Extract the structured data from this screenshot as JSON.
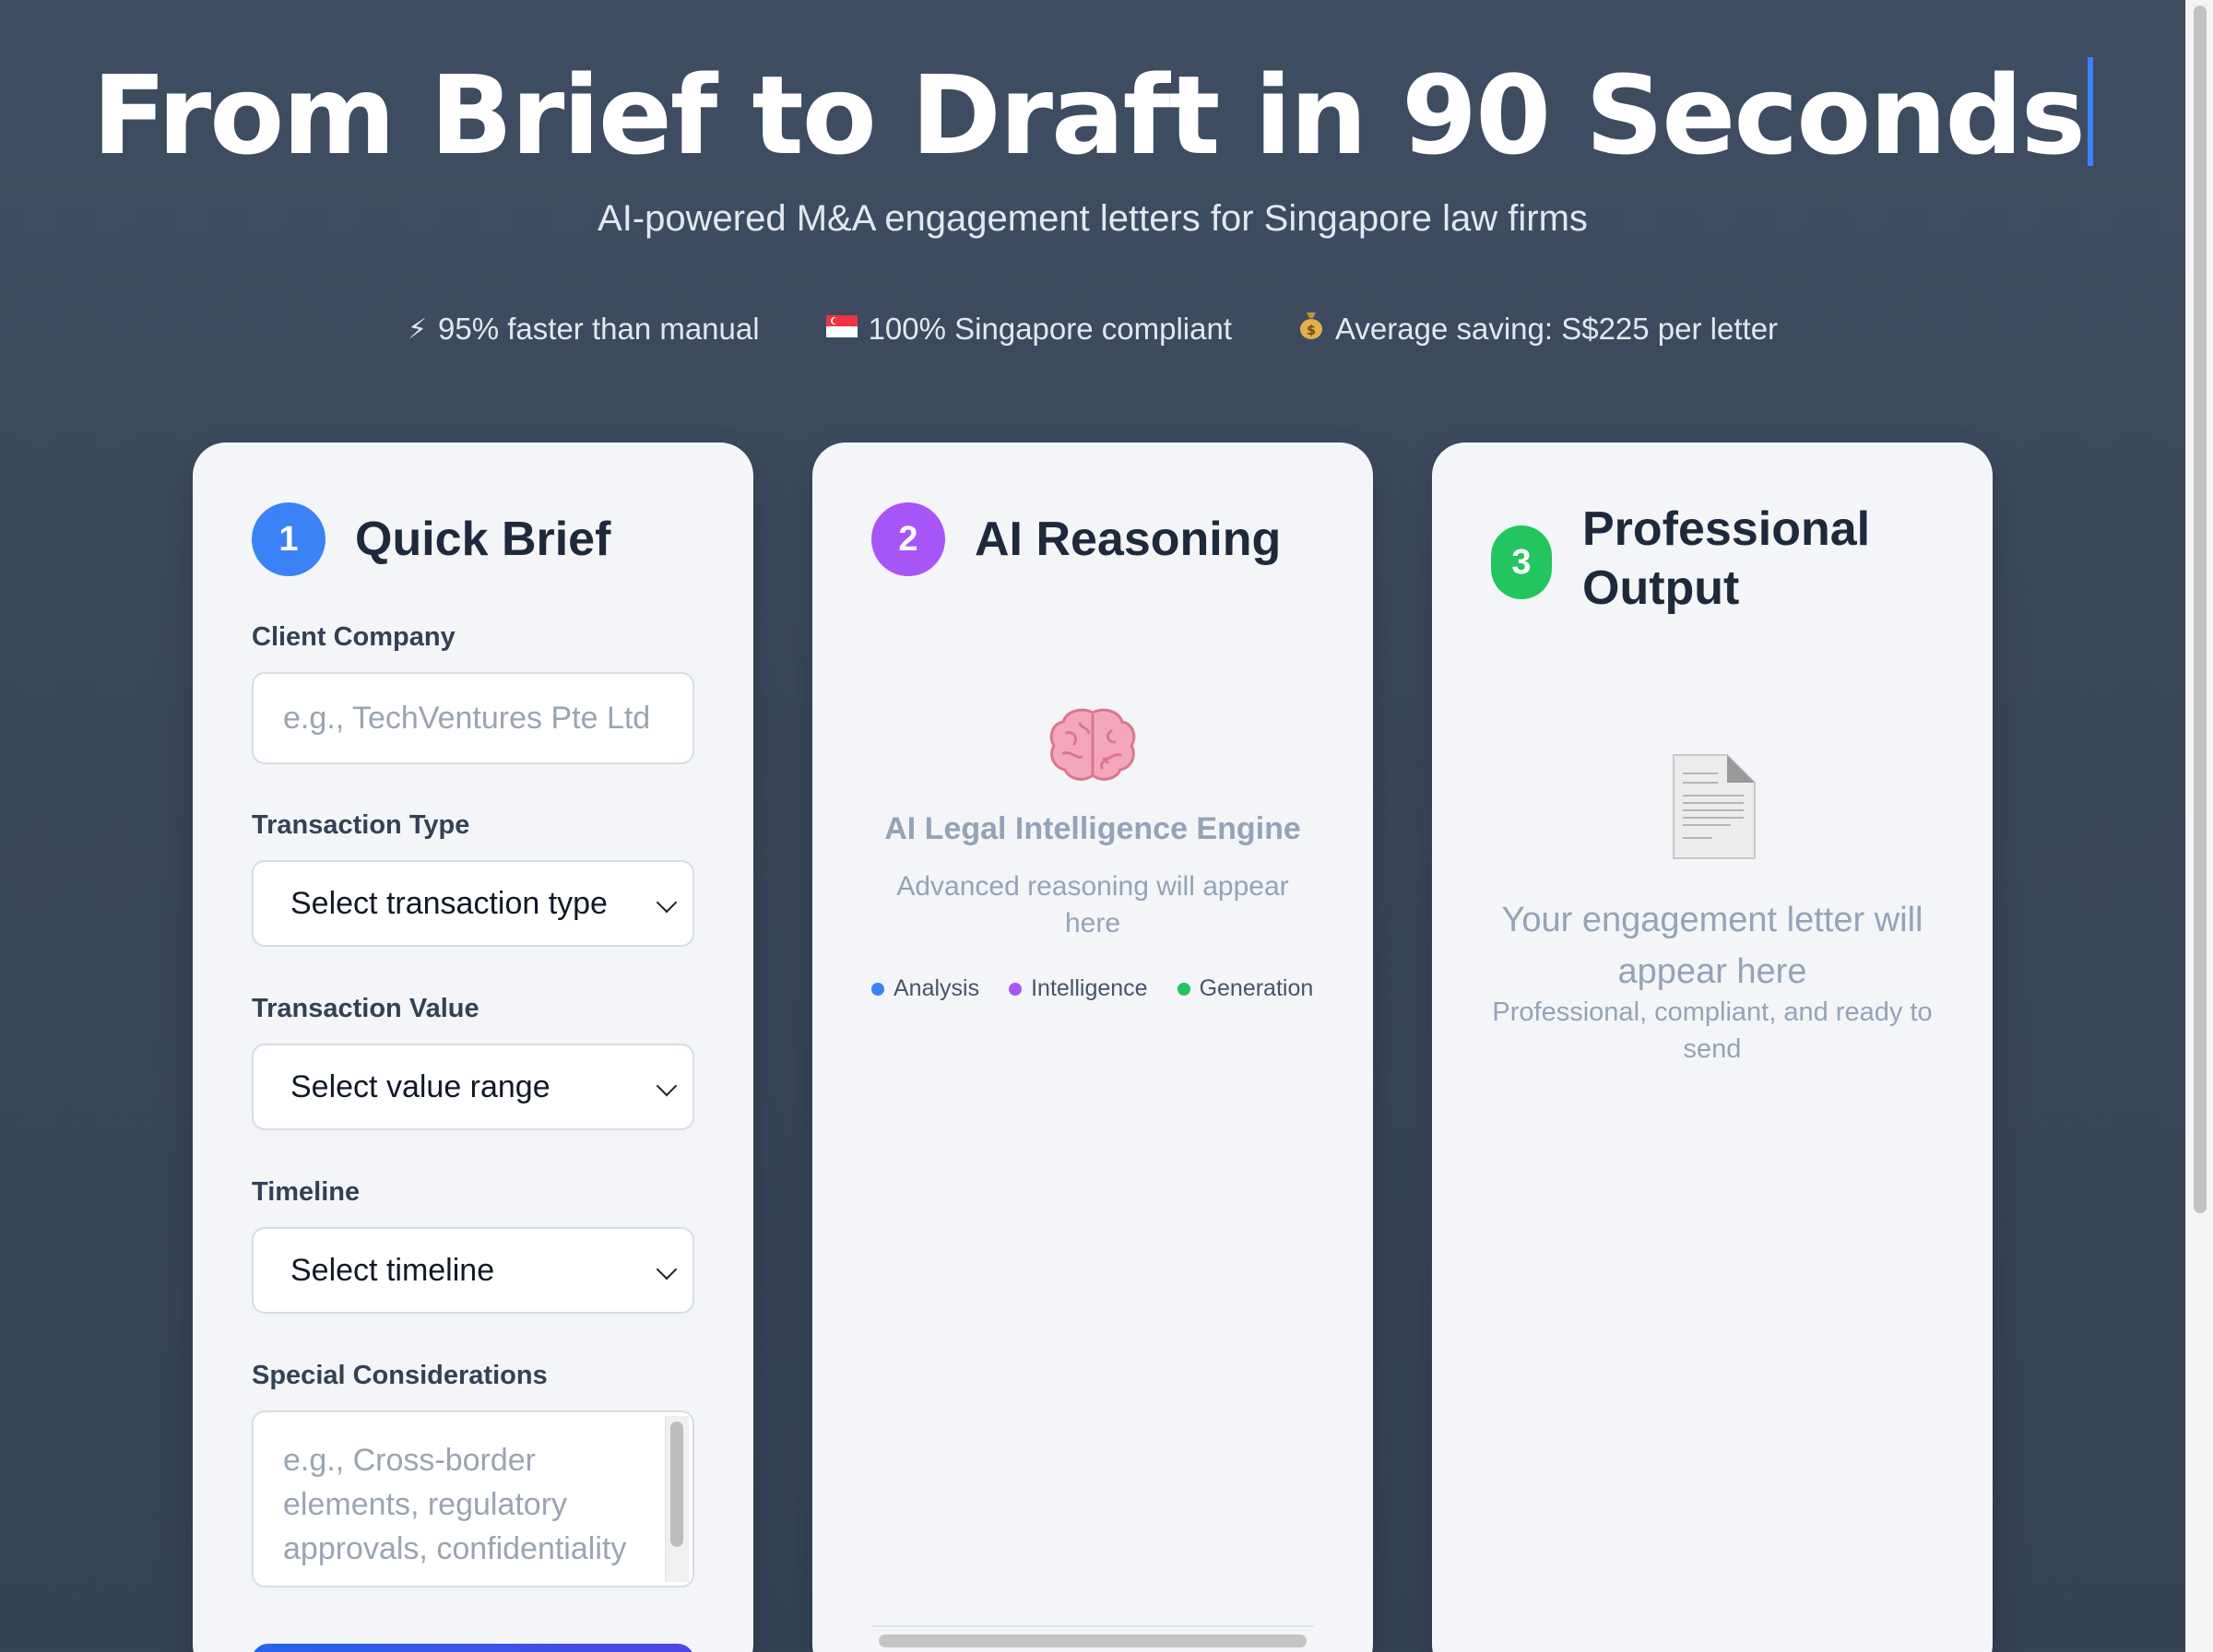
{
  "hero": {
    "title": "From Brief to Draft in 90 Seconds",
    "subtitle": "AI-powered M&A engagement letters for Singapore law firms",
    "stats": [
      {
        "icon": "lightning-icon",
        "glyph": "⚡",
        "text": "95% faster than manual"
      },
      {
        "icon": "singapore-flag-icon",
        "glyph": "🇸🇬",
        "text": "100% Singapore compliant"
      },
      {
        "icon": "money-bag-icon",
        "glyph": "💰",
        "text": "Average saving: S$225 per letter"
      }
    ]
  },
  "brief": {
    "step": "1",
    "title": "Quick Brief",
    "client_label": "Client Company",
    "client_placeholder": "e.g., TechVentures Pte Ltd",
    "transaction_type_label": "Transaction Type",
    "transaction_type_value": "Select transaction type",
    "transaction_value_label": "Transaction Value",
    "transaction_value_value": "Select value range",
    "timeline_label": "Timeline",
    "timeline_value": "Select timeline",
    "special_label": "Special Considerations",
    "special_placeholder": "e.g., Cross-border elements, regulatory approvals, confidentiality concerns"
  },
  "reasoning": {
    "step": "2",
    "title": "AI Reasoning",
    "engine_title": "AI Legal Intelligence Engine",
    "engine_subtitle": "Advanced reasoning will appear here",
    "legend": [
      {
        "label": "Analysis",
        "color": "#3b82f6"
      },
      {
        "label": "Intelligence",
        "color": "#a855f7"
      },
      {
        "label": "Generation",
        "color": "#22c55e"
      }
    ],
    "progress": 1.0
  },
  "output": {
    "step": "3",
    "title": "Professional Output",
    "placeholder_title": "Your engagement letter will appear here",
    "placeholder_subtitle": "Professional, compliant, and ready to send"
  },
  "colors": {
    "step1": "#3b82f6",
    "step2": "#a855f7",
    "step3": "#22c55e"
  }
}
